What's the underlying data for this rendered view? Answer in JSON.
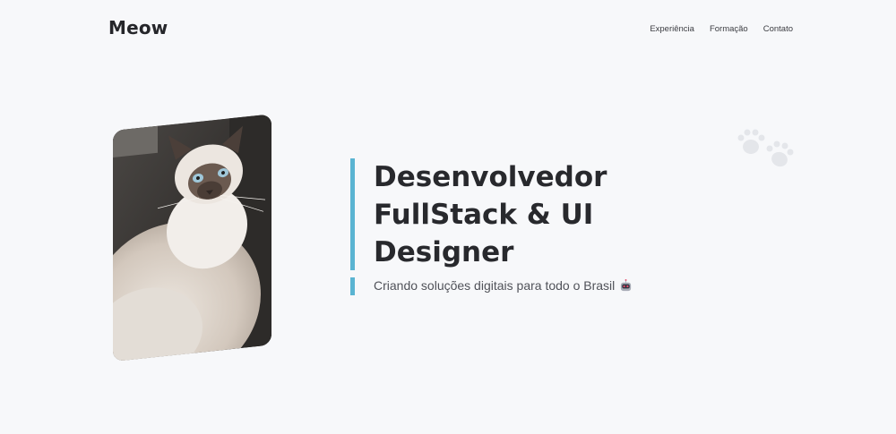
{
  "header": {
    "brand": "Meow",
    "nav": [
      {
        "label": "Experiência"
      },
      {
        "label": "Formação"
      },
      {
        "label": "Contato"
      }
    ]
  },
  "hero": {
    "headline_line1": "Desenvolvedor",
    "headline_line2": "FullStack & UI",
    "headline_line3": "Designer",
    "subtitle": "Criando soluções digitais para todo o Brasil",
    "subtitle_icon": "robot-icon",
    "image": "cat-photo",
    "decoration": "paw-prints-icon"
  },
  "colors": {
    "background": "#f7f8fa",
    "accent": "#5ab4d2",
    "text": "#28292d"
  }
}
